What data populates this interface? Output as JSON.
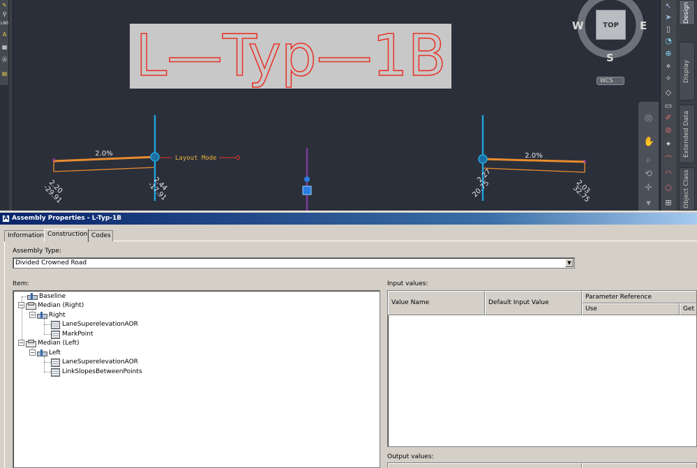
{
  "viewport": {
    "assembly_label": "L—Typ—1B",
    "left_lane": {
      "slope": "2.0%",
      "outer_offset": "2.20",
      "outer_station": "-29.91",
      "inner_offset": "2.44",
      "inner_station": "-17.91"
    },
    "right_lane": {
      "slope": "2.0%",
      "inner_offset": "2.27",
      "inner_station": "20.75",
      "outer_offset": "2.03",
      "outer_station": "32.75"
    },
    "layout_mode_label": "Layout Mode",
    "viewcube": {
      "north_hidden": "",
      "west": "W",
      "east": "E",
      "south": "S",
      "face": "TOP",
      "ucs": "WCS"
    },
    "palette_tabs": [
      "Design",
      "Display",
      "Extended Data",
      "Object Class"
    ],
    "colors": {
      "background": "#2b2f3a",
      "label_red": "#e8342a",
      "label_box": "#c8c8c8",
      "baseline_blue": "#1fa6e0",
      "lane_orange": "#e98d2d",
      "marker_magenta": "#d63bd6",
      "axis_purple": "#7a3d9a"
    }
  },
  "dialog": {
    "title": "Assembly Properties - L-Typ-1B",
    "app_icon": "A",
    "tabs": [
      {
        "label": "Information",
        "active": false
      },
      {
        "label": "Construction",
        "active": true
      },
      {
        "label": "Codes",
        "active": false
      }
    ],
    "assembly_type_label": "Assembly Type:",
    "assembly_type_value": "Divided Crowned Road",
    "item_label": "Item:",
    "tree": {
      "baseline": "Baseline",
      "median_right": "Median (Right)",
      "right": "Right",
      "right_sub1": "LaneSuperelevationAOR",
      "right_sub2": "MarkPoint",
      "median_left": "Median (Left)",
      "left": "Left",
      "left_sub1": "LaneSuperelevationAOR",
      "left_sub2": "LinkSlopesBetweenPoints"
    },
    "input_values_label": "Input values:",
    "input_columns": {
      "value_name": "Value Name",
      "default_input_value": "Default Input Value",
      "parameter_reference": "Parameter Reference",
      "use": "Use",
      "get_value": "Get Va"
    },
    "output_values_label": "Output values:"
  }
}
